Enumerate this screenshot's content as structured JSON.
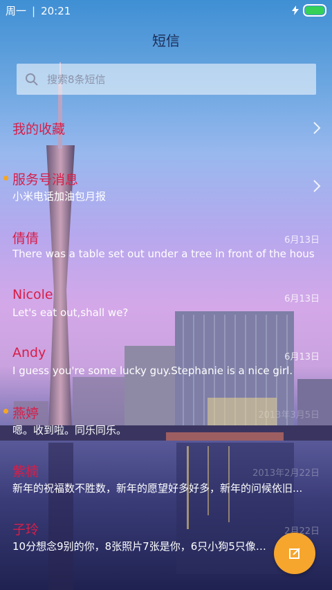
{
  "status": {
    "carrier": "周一",
    "time": "20:21",
    "icons": [
      "charging-bolt-icon",
      "battery-icon"
    ],
    "battery_color": "#34d058"
  },
  "header": {
    "title": "短信"
  },
  "search": {
    "placeholder": "搜索8条短信"
  },
  "rows": [
    {
      "name": "我的收藏",
      "preview": "",
      "date": "",
      "unread": false,
      "chevron": true
    },
    {
      "name": "服务号消息",
      "preview": "小米电话加油包月报",
      "date": "",
      "unread": true,
      "chevron": true
    },
    {
      "name": "倩倩",
      "preview": "There was a table set out under a tree in front of the hous",
      "date": "6月13日",
      "unread": false,
      "chevron": false
    },
    {
      "name": "Nicole",
      "preview": "Let's eat out,shall we?",
      "date": "6月13日",
      "unread": false,
      "chevron": false
    },
    {
      "name": "Andy",
      "preview": "I guess you're some lucky guy.Stephanie is a nice girl.",
      "date": "6月13日",
      "unread": false,
      "chevron": false
    },
    {
      "name": "燕婷",
      "preview": "嗯。收到啦。同乐同乐。",
      "date": "2013年3月5日",
      "unread": true,
      "chevron": false
    },
    {
      "name": "紫楠",
      "preview": "新年的祝福数不胜数，新年的愿望好多好多，新年的问候依旧...",
      "date": "2013年2月22日",
      "unread": false,
      "chevron": false
    },
    {
      "name": "子玲",
      "preview": "10分想念9别的你，8张照片7张是你，6只小狗5只像你，...",
      "date": "2月22日",
      "unread": false,
      "chevron": false
    }
  ],
  "fab": {
    "icon": "compose-icon",
    "color": "#f6a62d"
  }
}
